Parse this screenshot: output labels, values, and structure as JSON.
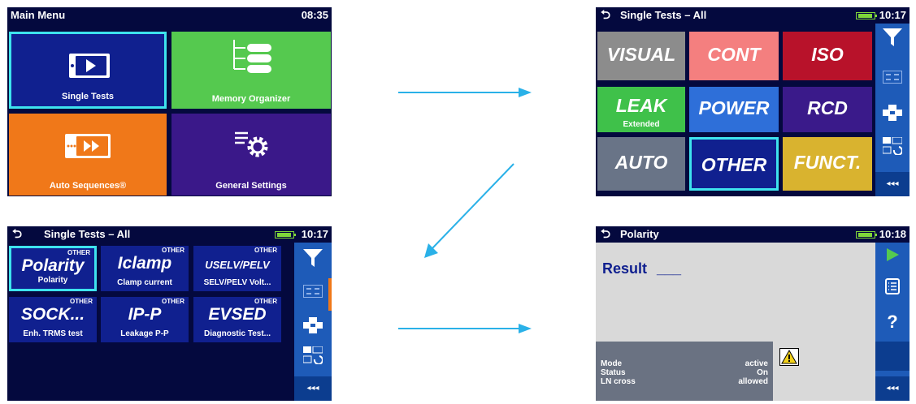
{
  "screen1": {
    "title": "Main Menu",
    "time": "08:35",
    "tiles": [
      {
        "label": "Single Tests",
        "color": "#10208f"
      },
      {
        "label": "Memory Organizer",
        "color": "#55c94f"
      },
      {
        "label": "Auto Sequences®",
        "color": "#f07819"
      },
      {
        "label": "General Settings",
        "color": "#3a1889"
      }
    ]
  },
  "screen2": {
    "back": "⮌",
    "title": "Single Tests – All",
    "time": "10:17",
    "tiles": [
      {
        "name": "VISUAL",
        "sub": "",
        "color": "#8c8c8c",
        "text": "#ffffff"
      },
      {
        "name": "CONT",
        "sub": "",
        "color": "#f47f7f",
        "text": "#ffffff"
      },
      {
        "name": "ISO",
        "sub": "",
        "color": "#b8122a",
        "text": "#ffffff"
      },
      {
        "name": "LEAK",
        "sub": "Extended",
        "color": "#3fc14a",
        "text": "#ffffff"
      },
      {
        "name": "POWER",
        "sub": "",
        "color": "#2e6fd9",
        "text": "#ffffff"
      },
      {
        "name": "RCD",
        "sub": "",
        "color": "#3a1a8a",
        "text": "#ffffff"
      },
      {
        "name": "AUTO",
        "sub": "",
        "color": "#697487",
        "text": "#ffffff"
      },
      {
        "name": "OTHER",
        "sub": "",
        "color": "#10208f",
        "text": "#ffffff"
      },
      {
        "name": "FUNCT.",
        "sub": "",
        "color": "#d9b32f",
        "text": "#ffffff"
      }
    ],
    "more": "◂◂◂"
  },
  "screen3": {
    "back": "⮌",
    "title": "Single Tests – All",
    "time": "10:17",
    "tiles": [
      {
        "group": "OTHER",
        "name": "Polarity",
        "sub": "Polarity"
      },
      {
        "group": "OTHER",
        "name": "Iclamp",
        "sub": "Clamp current"
      },
      {
        "group": "OTHER",
        "name": "USELV/PELV",
        "sub": "SELV/PELV Volt..."
      },
      {
        "group": "OTHER",
        "name": "SOCK...",
        "sub": "Enh. TRMS test"
      },
      {
        "group": "OTHER",
        "name": "IP-P",
        "sub": "Leakage P-P"
      },
      {
        "group": "OTHER",
        "name": "EVSED",
        "sub": "Diagnostic Test..."
      }
    ],
    "more": "◂◂◂"
  },
  "screen4": {
    "back": "⮌",
    "title": "Polarity",
    "time": "10:18",
    "result_label": "Result",
    "result_value": "___",
    "params": [
      {
        "name": "Mode",
        "value": "active"
      },
      {
        "name": "Status",
        "value": "On"
      },
      {
        "name": "LN cross",
        "value": "allowed"
      }
    ],
    "more": "◂◂◂"
  },
  "colors": {
    "arrow": "#2ab1e8",
    "header_bg": "#04093e",
    "side_bar": "#1e5bb8",
    "selected_border": "#3ee3ee",
    "battery": "#7fd63a"
  }
}
